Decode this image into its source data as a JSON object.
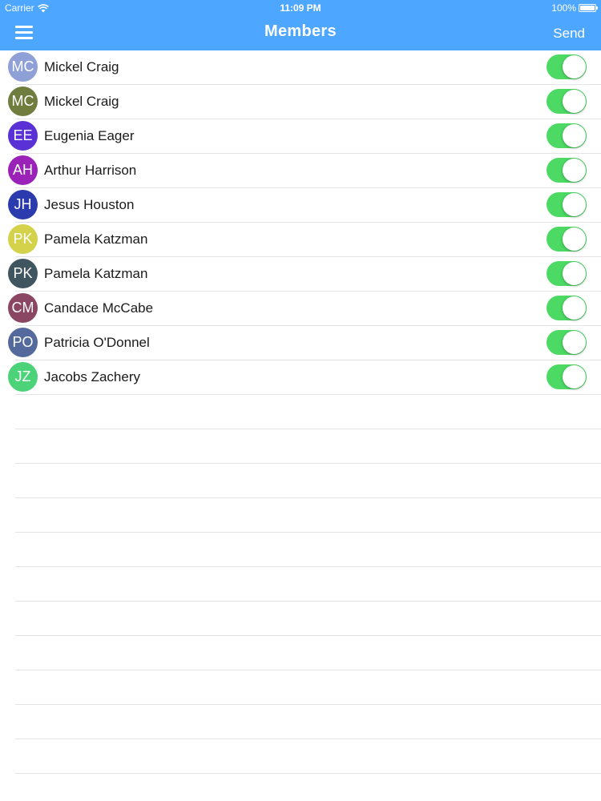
{
  "status_bar": {
    "carrier": "Carrier",
    "time": "11:09 PM",
    "battery": "100%"
  },
  "nav": {
    "title": "Members",
    "send_label": "Send"
  },
  "colors": {
    "nav_background": "#4da6ff",
    "toggle_on": "#4cd964"
  },
  "members": [
    {
      "initials": "MC",
      "name": "Mickel Craig",
      "color": "#8fa0d6",
      "enabled": true
    },
    {
      "initials": "MC",
      "name": "Mickel Craig",
      "color": "#6f7d3e",
      "enabled": true
    },
    {
      "initials": "EE",
      "name": "Eugenia Eager",
      "color": "#5a31d4",
      "enabled": true
    },
    {
      "initials": "AH",
      "name": "Arthur Harrison",
      "color": "#9b22b8",
      "enabled": true
    },
    {
      "initials": "JH",
      "name": "Jesus Houston",
      "color": "#2b3aad",
      "enabled": true
    },
    {
      "initials": "PK",
      "name": "Pamela Katzman",
      "color": "#d4d24a",
      "enabled": true
    },
    {
      "initials": "PK",
      "name": "Pamela Katzman",
      "color": "#3f5560",
      "enabled": true
    },
    {
      "initials": "CM",
      "name": "Candace McCabe",
      "color": "#8b4664",
      "enabled": true
    },
    {
      "initials": "PO",
      "name": "Patricia O'Donnel",
      "color": "#546a9c",
      "enabled": true
    },
    {
      "initials": "JZ",
      "name": "Jacobs Zachery",
      "color": "#4cd37a",
      "enabled": true
    }
  ],
  "empty_rows": 11
}
